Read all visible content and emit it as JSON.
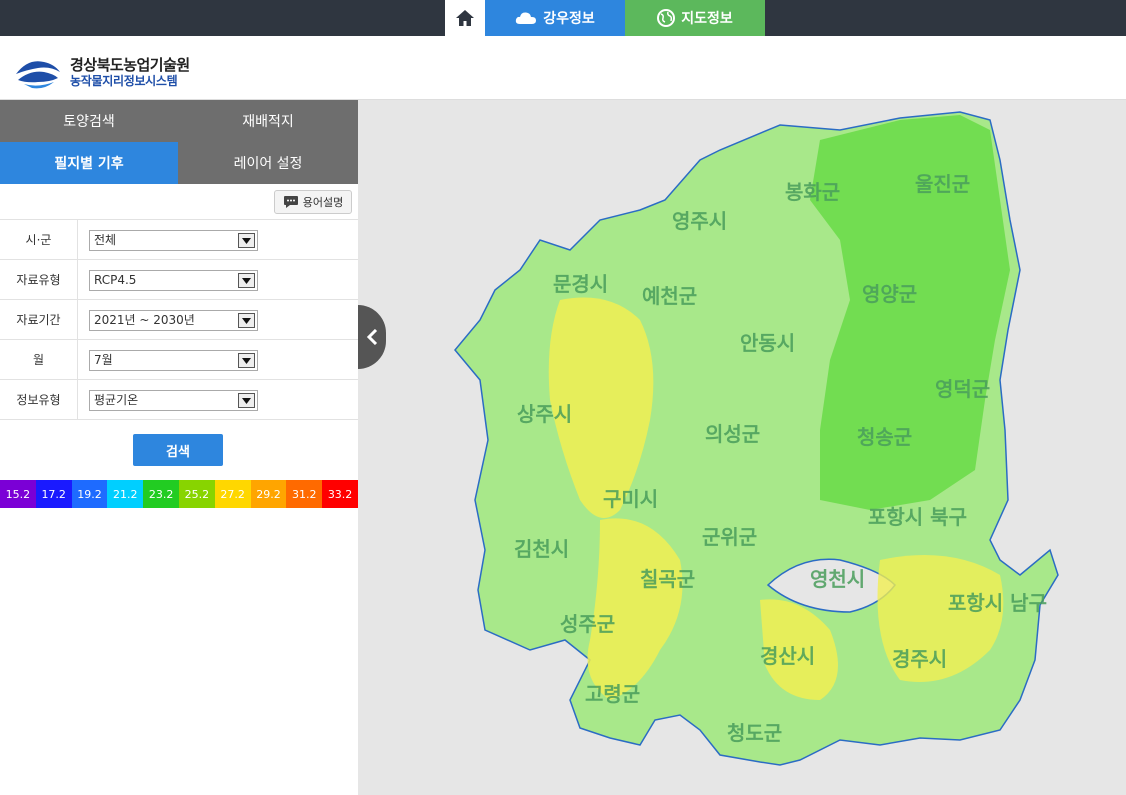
{
  "nav": {
    "home_icon": "home-icon",
    "rain_label": "강우정보",
    "map_label": "지도정보"
  },
  "header": {
    "org_name": "경상북도농업기술원",
    "system_name": "농작물지리정보시스템"
  },
  "tabs": [
    {
      "label": "토양검색"
    },
    {
      "label": "재배적지"
    },
    {
      "label": "필지별 기후"
    },
    {
      "label": "레이어 설정"
    }
  ],
  "glossary_label": "용어설명",
  "form": [
    {
      "label": "시·군",
      "value": "전체"
    },
    {
      "label": "자료유형",
      "value": "RCP4.5"
    },
    {
      "label": "자료기간",
      "value": "2021년 ~ 2030년"
    },
    {
      "label": "월",
      "value": "7월"
    },
    {
      "label": "정보유형",
      "value": "평균기온"
    }
  ],
  "search_label": "검색",
  "legend": [
    {
      "value": "15.2",
      "color": "#7b00d6"
    },
    {
      "value": "17.2",
      "color": "#1a1aff"
    },
    {
      "value": "19.2",
      "color": "#1e6bff"
    },
    {
      "value": "21.2",
      "color": "#00cfff"
    },
    {
      "value": "23.2",
      "color": "#22cc22"
    },
    {
      "value": "25.2",
      "color": "#88d400"
    },
    {
      "value": "27.2",
      "color": "#ffd700"
    },
    {
      "value": "29.2",
      "color": "#ffa500"
    },
    {
      "value": "31.2",
      "color": "#ff6a00"
    },
    {
      "value": "33.2",
      "color": "#ff0000"
    }
  ],
  "map_labels": [
    "영주시",
    "봉화군",
    "울진군",
    "문경시",
    "예천군",
    "영양군",
    "안동시",
    "영덕군",
    "상주시",
    "의성군",
    "청송군",
    "구미시",
    "포항시 북구",
    "김천시",
    "군위군",
    "칠곡군",
    "영천시",
    "포항시 남구",
    "성주군",
    "경산시",
    "경주시",
    "고령군",
    "청도군"
  ]
}
